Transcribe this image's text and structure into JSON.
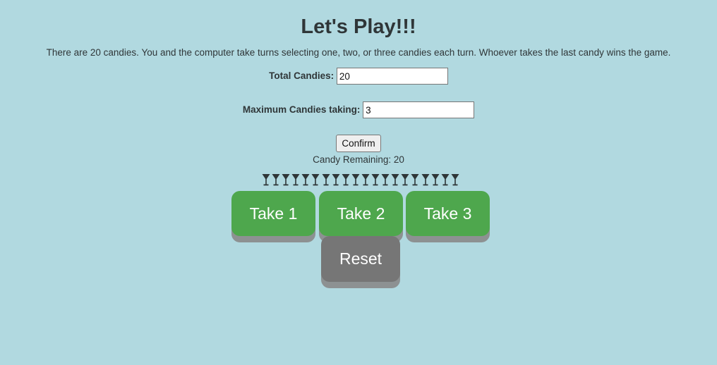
{
  "header": {
    "title": "Let's Play!!!",
    "description": "There are 20 candies. You and the computer take turns selecting one, two, or three candies each turn. Whoever takes the last candy wins the game."
  },
  "form": {
    "total_label": "Total Candies:",
    "total_value": "20",
    "max_label": "Maximum Candies taking:",
    "max_value": "3",
    "confirm_label": "Confirm"
  },
  "status": {
    "remaining_text": "Candy Remaining: 20",
    "candy_count": 20,
    "candy_icon": "martini-glass-icon",
    "candy_color": "#2f3638"
  },
  "controls": {
    "take1_label": "Take 1",
    "take2_label": "Take 2",
    "take3_label": "Take 3",
    "reset_label": "Reset"
  },
  "colors": {
    "background": "#b1d9e0",
    "take_button": "#4ea74d",
    "reset_button": "#767676",
    "button_shadow": "#8d9192"
  }
}
